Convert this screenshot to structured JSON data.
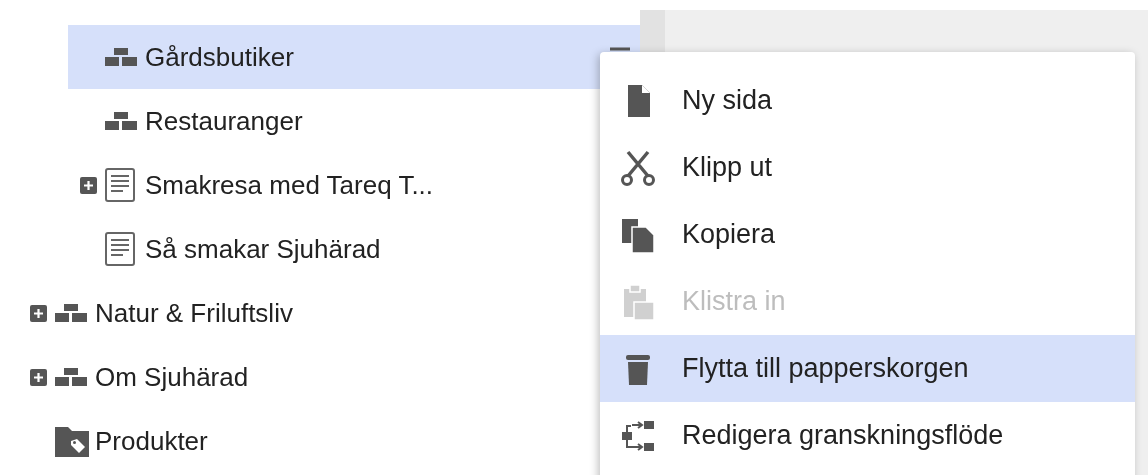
{
  "tree": {
    "continued_children": [
      {
        "label": "Gårdsbutiker",
        "kind": "section",
        "expandable": false,
        "selected": true
      },
      {
        "label": "Restauranger",
        "kind": "section",
        "expandable": false,
        "selected": false
      },
      {
        "label": "Smakresa med Tareq T...",
        "kind": "page",
        "expandable": true,
        "selected": false
      },
      {
        "label": "Så smakar Sjuhärad",
        "kind": "page",
        "expandable": false,
        "selected": false
      }
    ],
    "items": [
      {
        "label": "Natur & Friluftsliv",
        "kind": "section",
        "expandable": true,
        "selected": false
      },
      {
        "label": "Om Sjuhärad",
        "kind": "section",
        "expandable": true,
        "selected": false
      },
      {
        "label": "Produkter",
        "kind": "folder",
        "expandable": false,
        "selected": false
      }
    ]
  },
  "context_menu": {
    "items": [
      {
        "label": "Ny sida",
        "disabled": false,
        "selected": false
      },
      {
        "label": "Klipp ut",
        "disabled": false,
        "selected": false
      },
      {
        "label": "Kopiera",
        "disabled": false,
        "selected": false
      },
      {
        "label": "Klistra in",
        "disabled": true,
        "selected": false
      },
      {
        "label": "Flytta till papperskorgen",
        "disabled": false,
        "selected": true
      },
      {
        "label": "Redigera granskningsflöde",
        "disabled": false,
        "selected": false
      }
    ]
  }
}
